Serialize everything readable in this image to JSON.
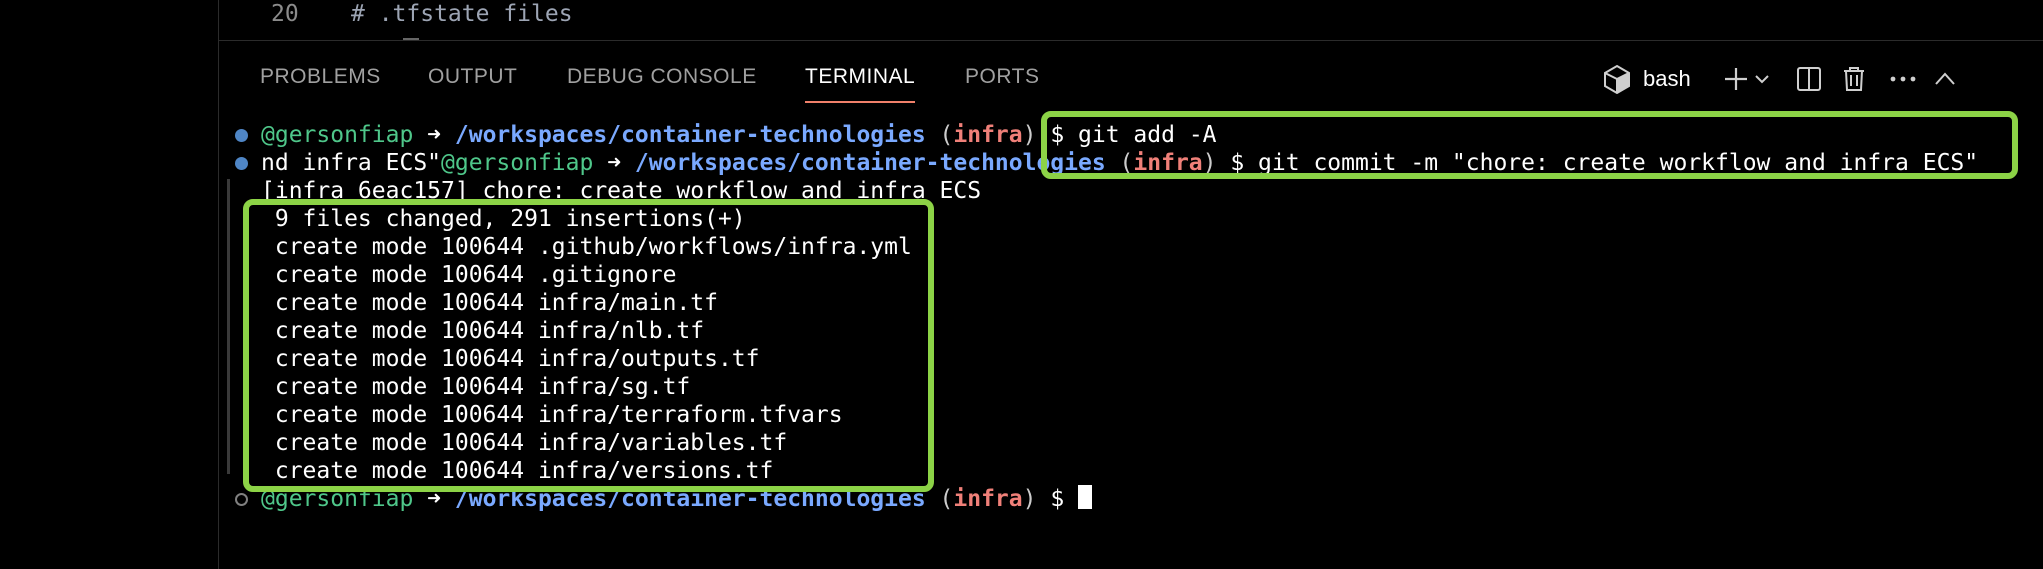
{
  "editor": {
    "line_number": "20",
    "line_text": "# .tfstate files"
  },
  "tabs": [
    {
      "label": "PROBLEMS",
      "active": false
    },
    {
      "label": "OUTPUT",
      "active": false
    },
    {
      "label": "DEBUG CONSOLE",
      "active": false
    },
    {
      "label": "TERMINAL",
      "active": true
    },
    {
      "label": "PORTS",
      "active": false
    }
  ],
  "toolbar": {
    "shell_label": "bash",
    "icons": [
      "terminal-shell-icon",
      "plus-icon",
      "chevron-down-icon",
      "split-icon",
      "trash-icon",
      "ellipsis-icon",
      "chevron-up-icon"
    ]
  },
  "terminal": {
    "line1": {
      "user": "@gersonfiap",
      "arrow": " ➜ ",
      "path": "/workspaces/container-technologies",
      "paren_open": " (",
      "branch": "infra",
      "paren_close": ")",
      "command": " $ git add -A"
    },
    "line2": {
      "prefix": "nd infra ECS\"",
      "user": "@gersonfiap",
      "arrow": " ➜ ",
      "path": "/workspaces/container-technologies",
      "paren_open": " (",
      "branch": "infra",
      "paren_close": ")",
      "command": " $ git commit -m \"chore: create workflow and infra ECS\""
    },
    "commit_line": "[infra 6eac157] chore: create workflow and infra ECS",
    "output_lines": [
      " 9 files changed, 291 insertions(+)",
      " create mode 100644 .github/workflows/infra.yml",
      " create mode 100644 .gitignore",
      " create mode 100644 infra/main.tf",
      " create mode 100644 infra/nlb.tf",
      " create mode 100644 infra/outputs.tf",
      " create mode 100644 infra/sg.tf",
      " create mode 100644 infra/terraform.tfvars",
      " create mode 100644 infra/variables.tf",
      " create mode 100644 infra/versions.tf"
    ],
    "prompt": {
      "user": "@gersonfiap",
      "arrow": " ➜ ",
      "path": "/workspaces/container-technologies",
      "paren_open": " (",
      "branch": "infra",
      "paren_close": ")",
      "command": " $ "
    }
  },
  "colors": {
    "highlight": "#8cd346",
    "user": "#4fc78a",
    "path": "#7aa9ff",
    "branch": "#f08079",
    "active_tab_underline": "#f0806a"
  }
}
